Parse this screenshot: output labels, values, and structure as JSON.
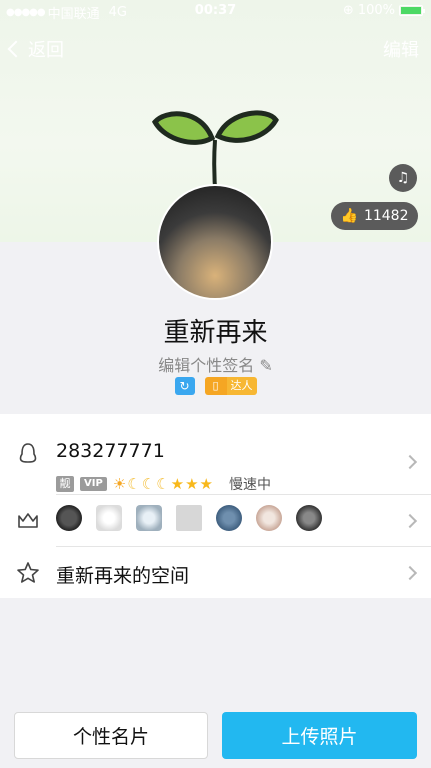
{
  "status_bar": {
    "signal": "●●●●●",
    "carrier": "中国联通",
    "network": "4G",
    "time": "00:37",
    "battery": "100%"
  },
  "nav": {
    "back_label": "返回",
    "edit_label": "编辑"
  },
  "profile": {
    "likes": "11482",
    "name": "重新再来",
    "signature": "编辑个性签名",
    "talent_label": "达人"
  },
  "qq_row": {
    "qq_number": "283277771",
    "tag_liang": "靓",
    "tag_vip": "VIP",
    "level_icons": [
      "sun",
      "moon",
      "moon",
      "moon",
      "star",
      "star",
      "star"
    ],
    "speed_text": "慢速中"
  },
  "space_row": {
    "label": "重新再来的空间"
  },
  "buttons": {
    "card_label": "个性名片",
    "upload_label": "上传照片"
  },
  "colors": {
    "accent": "#22b8f0",
    "sprout_leaf": "#8bc34a",
    "badge_blue": "#3aa7ef",
    "badge_orange": "#f5a623"
  }
}
